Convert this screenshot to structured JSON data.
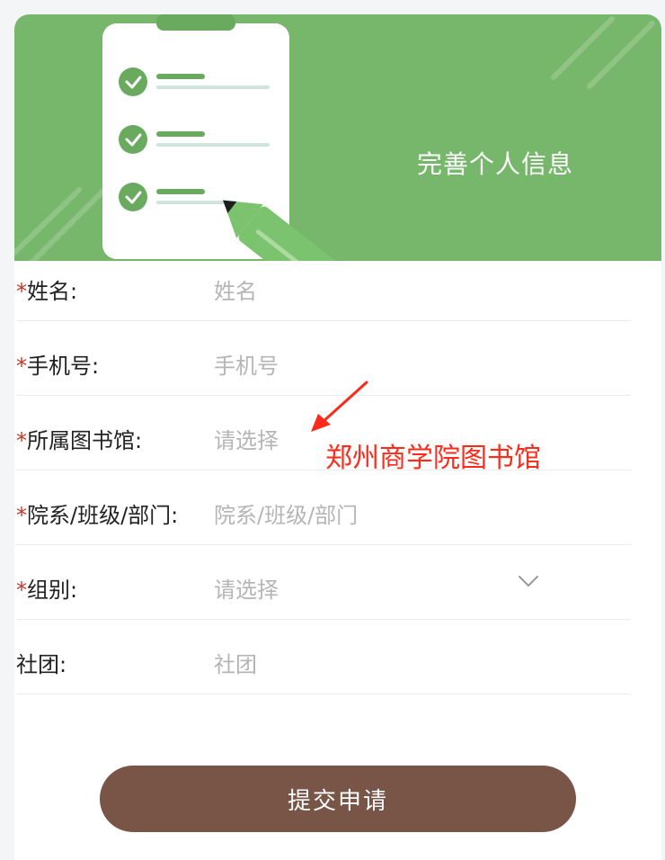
{
  "banner": {
    "title": "完善个人信息",
    "illustration": "clipboard-checklist-with-pencil"
  },
  "form": {
    "fields": [
      {
        "required": true,
        "label": "姓名:",
        "value": "姓名",
        "type": "text"
      },
      {
        "required": true,
        "label": "手机号:",
        "value": "手机号",
        "type": "text"
      },
      {
        "required": true,
        "label": "所属图书馆:",
        "value": "请选择",
        "type": "picker"
      },
      {
        "required": true,
        "label": "院系/班级/部门:",
        "value": "院系/班级/部门",
        "type": "text"
      },
      {
        "required": true,
        "label": "组别:",
        "value": "请选择",
        "type": "select",
        "icon": "chevron-down-icon"
      },
      {
        "required": false,
        "label": "社团:",
        "value": "社团",
        "type": "text"
      }
    ],
    "required_mark": "*"
  },
  "annotation": {
    "text": "郑州商学院图书馆",
    "color": "#ff2a1a"
  },
  "submit": {
    "label": "提交申请",
    "color": "#795548"
  },
  "colors": {
    "banner": "#77b76b",
    "required_star": "#c0392b"
  }
}
